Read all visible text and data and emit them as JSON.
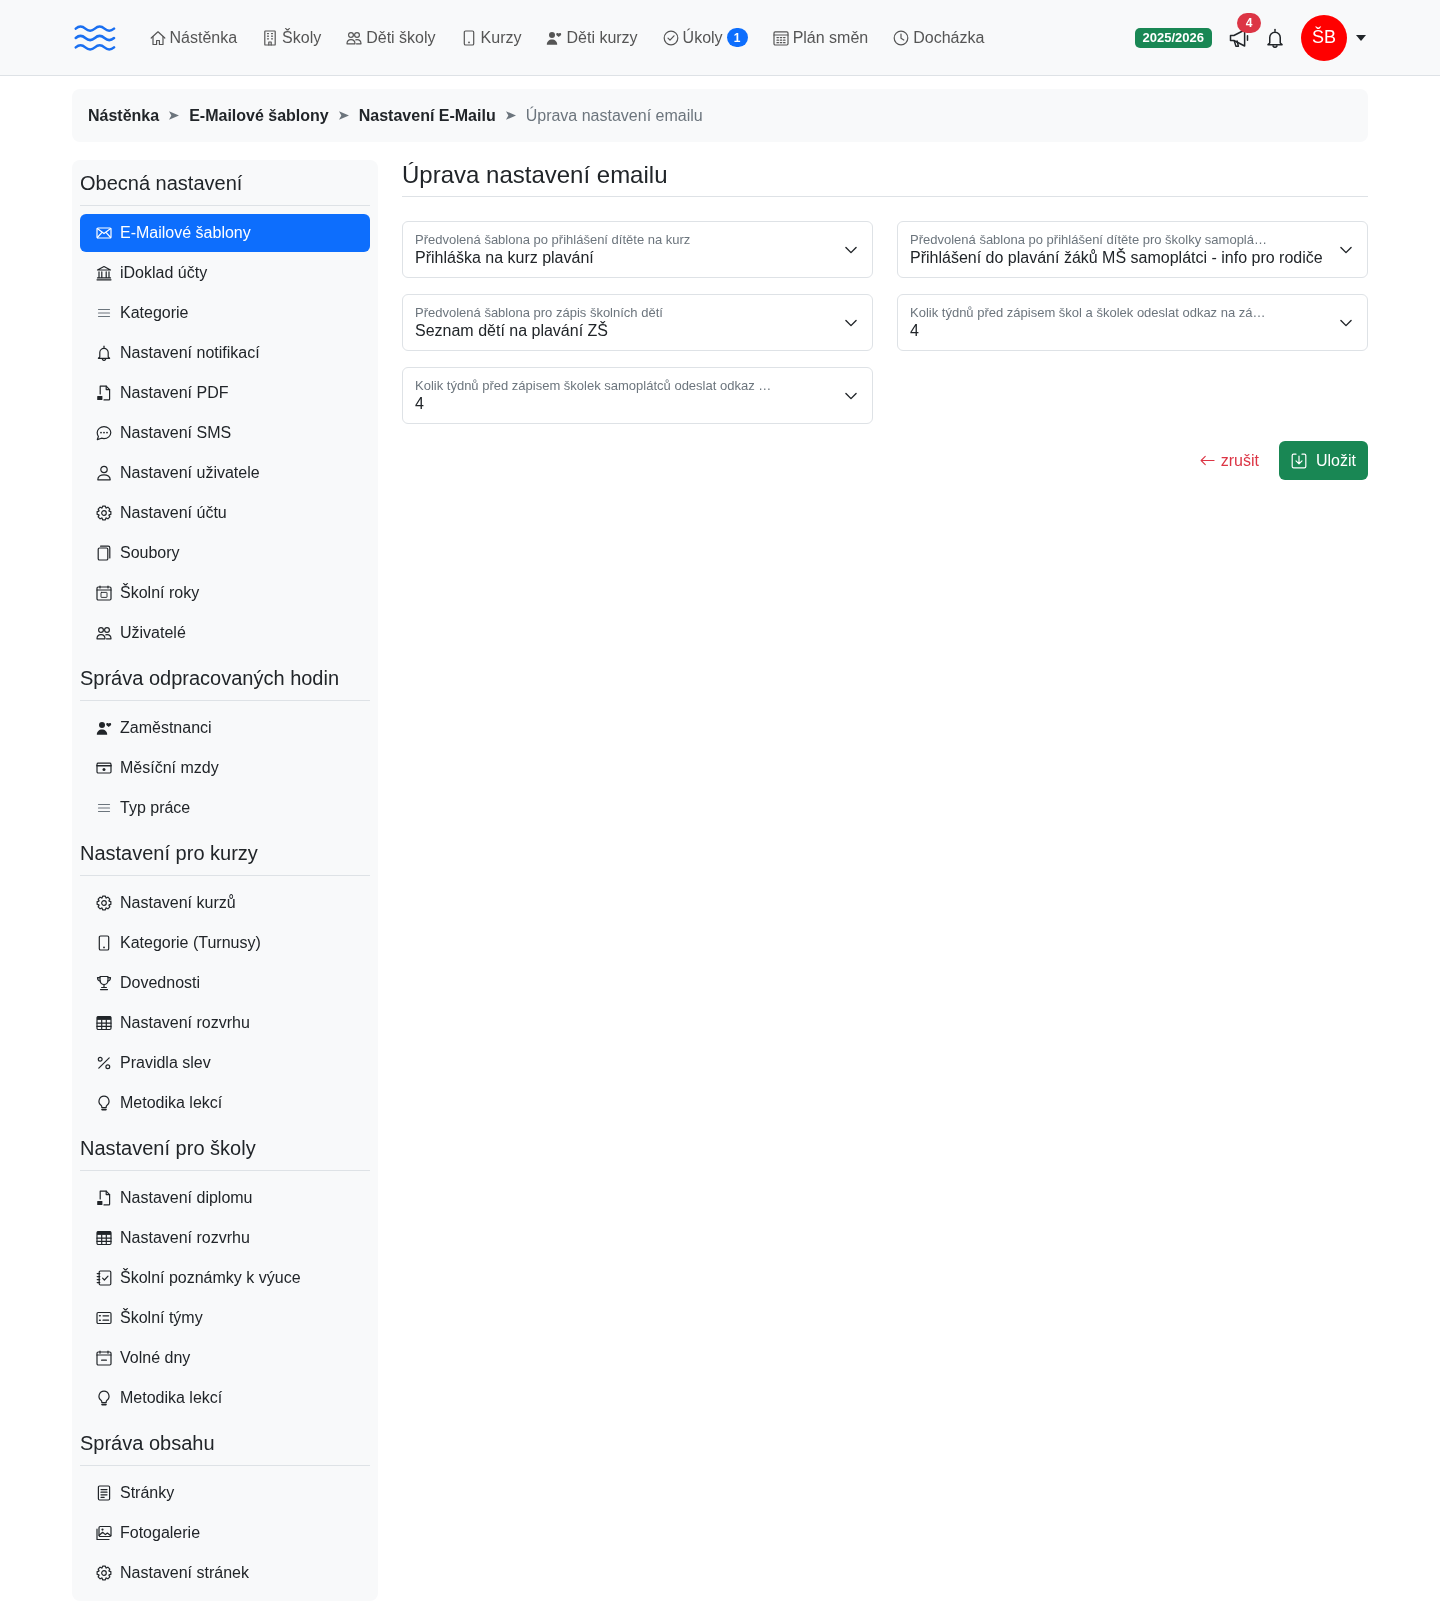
{
  "navbar": {
    "items": [
      {
        "label": "Nástěnka",
        "selected": false
      },
      {
        "label": "Školy",
        "selected": false
      },
      {
        "label": "Děti školy",
        "selected": false
      },
      {
        "label": "Kurzy",
        "selected": false
      },
      {
        "label": "Děti kurzy",
        "selected": false
      },
      {
        "label": "Úkoly",
        "badge": "1",
        "selected": false
      },
      {
        "label": "Plán směn",
        "selected": false
      },
      {
        "label": "Docházka",
        "selected": false
      }
    ],
    "year": "2025/2026",
    "announcements_count": "4",
    "avatar_initials": "ŠB"
  },
  "breadcrumb": [
    {
      "label": "Nástěnka",
      "current": false
    },
    {
      "label": "E-Mailové šablony",
      "current": false
    },
    {
      "label": "Nastavení E-Mailu",
      "current": false
    },
    {
      "label": "Úprava nastavení emailu",
      "current": true
    }
  ],
  "sidebar": {
    "sections": [
      {
        "title": "Obecná nastavení",
        "items": [
          {
            "label": "E-Mailové šablony",
            "selected": true
          },
          {
            "label": "iDoklad účty",
            "selected": false
          },
          {
            "label": "Kategorie",
            "selected": false
          },
          {
            "label": "Nastavení notifikací",
            "selected": false
          },
          {
            "label": "Nastavení PDF",
            "selected": false
          },
          {
            "label": "Nastavení SMS",
            "selected": false
          },
          {
            "label": "Nastavení uživatele",
            "selected": false
          },
          {
            "label": "Nastavení účtu",
            "selected": false
          },
          {
            "label": "Soubory",
            "selected": false
          },
          {
            "label": "Školní roky",
            "selected": false
          },
          {
            "label": "Uživatelé",
            "selected": false
          }
        ]
      },
      {
        "title": "Správa odpracovaných hodin",
        "items": [
          {
            "label": "Zaměstnanci",
            "selected": false
          },
          {
            "label": "Měsíční mzdy",
            "selected": false
          },
          {
            "label": "Typ práce",
            "selected": false
          }
        ]
      },
      {
        "title": "Nastavení pro kurzy",
        "items": [
          {
            "label": "Nastavení kurzů",
            "selected": false
          },
          {
            "label": "Kategorie (Turnusy)",
            "selected": false
          },
          {
            "label": "Dovednosti",
            "selected": false
          },
          {
            "label": "Nastavení rozvrhu",
            "selected": false
          },
          {
            "label": "Pravidla slev",
            "selected": false
          },
          {
            "label": "Metodika lekcí",
            "selected": false
          }
        ]
      },
      {
        "title": "Nastavení pro školy",
        "items": [
          {
            "label": "Nastavení diplomu",
            "selected": false
          },
          {
            "label": "Nastavení rozvrhu",
            "selected": false
          },
          {
            "label": "Školní poznámky k výuce",
            "selected": false
          },
          {
            "label": "Školní týmy",
            "selected": false
          },
          {
            "label": "Volné dny",
            "selected": false
          },
          {
            "label": "Metodika lekcí",
            "selected": false
          }
        ]
      },
      {
        "title": "Správa obsahu",
        "items": [
          {
            "label": "Stránky",
            "selected": false
          },
          {
            "label": "Fotogalerie",
            "selected": false
          },
          {
            "label": "Nastavení stránek",
            "selected": false
          }
        ]
      }
    ]
  },
  "page_title": "Úprava nastavení emailu",
  "fields": [
    {
      "label": "Předvolená šablona po přihlášení dítěte na kurz",
      "value": "Přihláška na kurz plavání"
    },
    {
      "label": "Předvolená šablona po přihlášení dítěte pro školky samoplá…",
      "value": "Přihlášení do plavání žáků MŠ samoplátci - info pro rodiče"
    },
    {
      "label": "Předvolená šablona pro zápis školních dětí",
      "value": "Seznam dětí na plavání ZŠ"
    },
    {
      "label": "Kolik týdnů před zápisem škol a školek odeslat odkaz na zá…",
      "value": "4"
    },
    {
      "label": "Kolik týdnů před zápisem školek samoplátců odeslat odkaz …",
      "value": "4"
    }
  ],
  "actions": {
    "cancel": "zrušit",
    "save": "Uložit"
  }
}
